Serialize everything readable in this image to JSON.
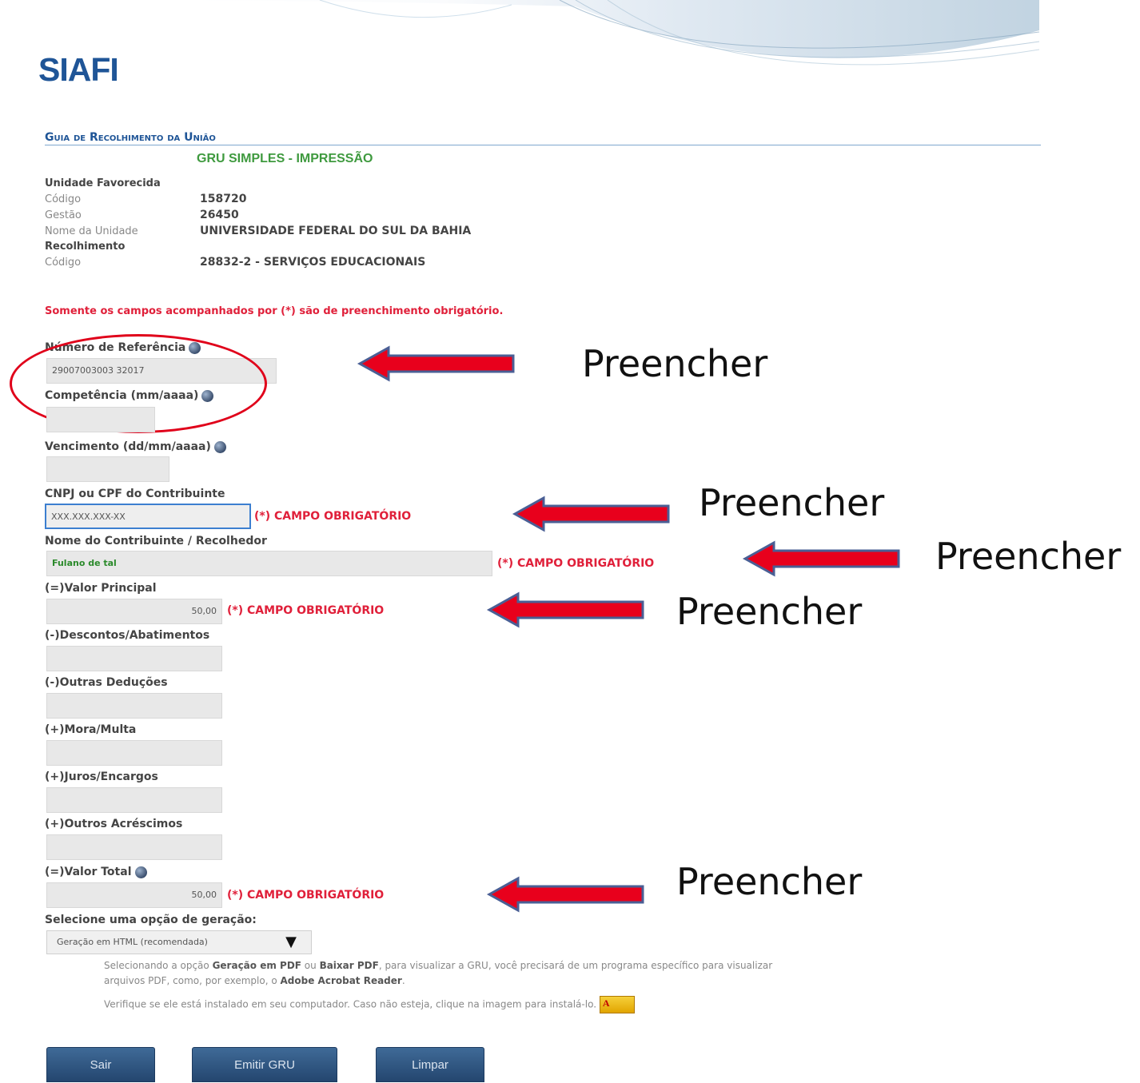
{
  "header": {
    "logo": "SIAFI"
  },
  "title": {
    "main": "Guia de Recolhimento da União",
    "sub": "GRU SIMPLES - IMPRESSÃO"
  },
  "unidade": {
    "heading": "Unidade Favorecida",
    "rows": [
      {
        "label": "Código",
        "value": "158720"
      },
      {
        "label": "Gestão",
        "value": "26450"
      },
      {
        "label": "Nome da Unidade",
        "value": "UNIVERSIDADE FEDERAL DO SUL DA BAHIA"
      }
    ]
  },
  "recolhimento": {
    "heading": "Recolhimento",
    "rows": [
      {
        "label": "Código",
        "value": "28832-2 - SERVIÇOS EDUCACIONAIS"
      }
    ]
  },
  "required_note": "Somente os campos acompanhados por (*) são de preenchimento obrigatório.",
  "required_text": "(*) CAMPO OBRIGATÓRIO",
  "fields": {
    "referencia": {
      "label": "Número de Referência",
      "value": "29007003003 32017"
    },
    "competencia": {
      "label": "Competência (mm/aaaa)",
      "value": ""
    },
    "vencimento": {
      "label": "Vencimento (dd/mm/aaaa)",
      "value": ""
    },
    "cnpj": {
      "label": "CNPJ ou CPF do Contribuinte",
      "value": "XXX.XXX.XXX-XX"
    },
    "nome": {
      "label": "Nome do Contribuinte / Recolhedor",
      "value": "Fulano de tal"
    },
    "valor_principal": {
      "label": "(=)Valor Principal",
      "value": "50,00"
    },
    "descontos": {
      "label": "(-)Descontos/Abatimentos",
      "value": ""
    },
    "outras_deducoes": {
      "label": "(-)Outras Deduções",
      "value": ""
    },
    "mora": {
      "label": "(+)Mora/Multa",
      "value": ""
    },
    "juros": {
      "label": "(+)Juros/Encargos",
      "value": ""
    },
    "outros_acrescimos": {
      "label": "(+)Outros Acréscimos",
      "value": ""
    },
    "valor_total": {
      "label": "(=)Valor Total",
      "value": "50,00"
    }
  },
  "geracao": {
    "label": "Selecione uma opção de geração:",
    "selected": "Geração em HTML (recomendada)",
    "help1a": "Selecionando a opção ",
    "help1b": "Geração em PDF",
    "help1c": " ou ",
    "help1d": "Baixar PDF",
    "help1e": ", para visualizar a GRU, você precisará de um programa específico para visualizar",
    "help2a": "arquivos PDF, como, por exemplo, o ",
    "help2b": "Adobe Acrobat Reader",
    "help2c": ".",
    "help3": "Verifique se ele está instalado em seu computador. Caso não esteja, clique na imagem para instalá-lo."
  },
  "buttons": {
    "sair": "Sair",
    "emitir": "Emitir GRU",
    "limpar": "Limpar"
  },
  "annotation": "Preencher",
  "colors": {
    "brand": "#1f5597",
    "accent_green": "#3f9a3f",
    "required_red": "#e0203a",
    "arrow_red": "#e8001c"
  }
}
